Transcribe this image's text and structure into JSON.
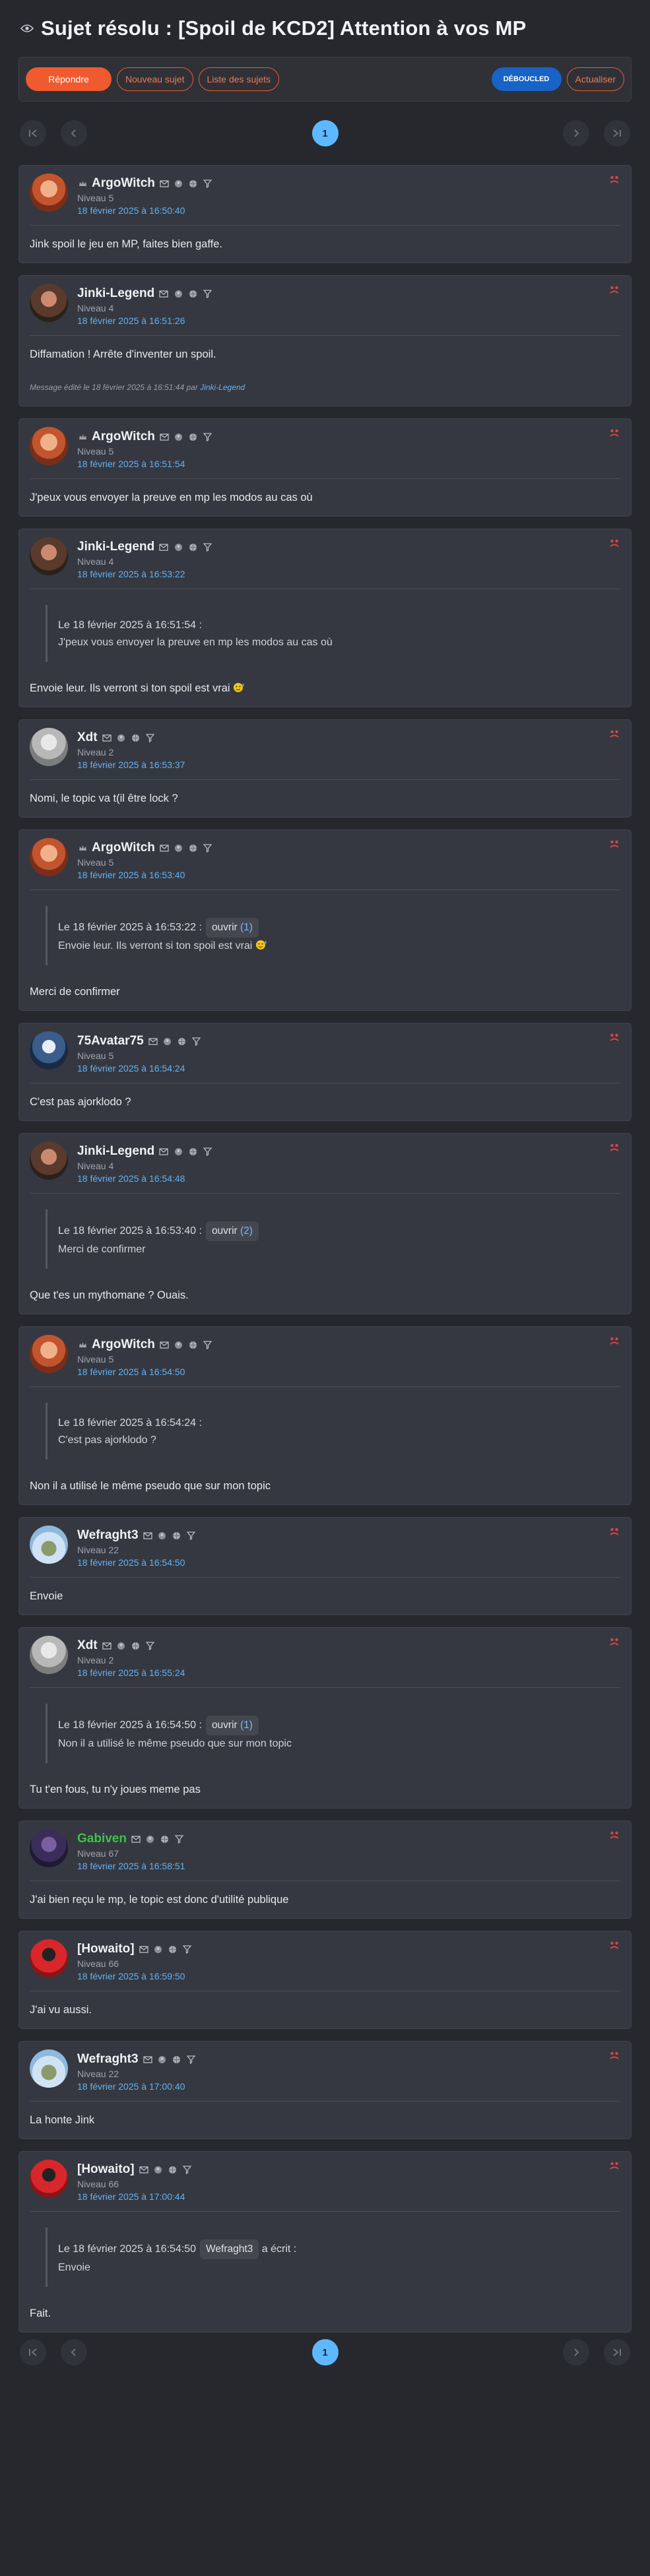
{
  "topic": {
    "title": "Sujet résolu : [Spoil de KCD2] Attention à vos MP",
    "icon": "eye-icon"
  },
  "actions": {
    "reply": "Répondre",
    "new_topic": "Nouveau sujet",
    "topic_list": "Liste des sujets",
    "debug_badge": "DÉBOUCLED",
    "refresh": "Actualiser"
  },
  "pager": {
    "current": "1"
  },
  "edited_label": {
    "prefix": "Message édité le 18 février 2025 à 16:51:44 par",
    "author": "Jinki-Legend"
  },
  "posts": [
    {
      "author": "ArgoWitch",
      "level": "Niveau 5",
      "date": "18 février 2025 à 16:50:40",
      "text": "Jink spoil le jeu en MP, faites bien gaffe."
    },
    {
      "author": "Jinki-Legend",
      "level": "Niveau 4",
      "date": "18 février 2025 à 16:51:26",
      "text": "Diffamation ! Arrête d'inventer un spoil."
    },
    {
      "author": "ArgoWitch",
      "level": "Niveau 5",
      "date": "18 février 2025 à 16:51:54",
      "text": "J'peux vous envoyer la preuve en mp les modos au cas où"
    },
    {
      "author": "Jinki-Legend",
      "level": "Niveau 4",
      "date": "18 février 2025 à 16:53:22",
      "quote_head": "Le 18 février 2025 à 16:51:54 :",
      "quote_text": "J'peux vous envoyer la preuve en mp les modos au cas où",
      "text": "Envoie leur. Ils verront si ton spoil est vrai"
    },
    {
      "author": "Xdt",
      "level": "Niveau 2",
      "date": "18 février 2025 à 16:53:37",
      "text": "Nomi, le topic va t(il être lock ?"
    },
    {
      "author": "ArgoWitch",
      "level": "Niveau 5",
      "date": "18 février 2025 à 16:53:40",
      "quote_head": "Le 18 février 2025 à 16:53:22 :",
      "quote_pill": "ouvrir",
      "quote_count": "(1)",
      "quote_text": "Envoie leur. Ils verront si ton spoil est vrai",
      "text": "Merci de confirmer"
    },
    {
      "author": "75Avatar75",
      "level": "Niveau 5",
      "date": "18 février 2025 à 16:54:24",
      "text": "C'est pas ajorklodo ?"
    },
    {
      "author": "Jinki-Legend",
      "level": "Niveau 4",
      "date": "18 février 2025 à 16:54:48",
      "quote_head": "Le 18 février 2025 à 16:53:40 :",
      "quote_pill": "ouvrir",
      "quote_count": "(2)",
      "quote_text": "Merci de confirmer",
      "text": "Que t'es un mythomane ? Ouais."
    },
    {
      "author": "ArgoWitch",
      "level": "Niveau 5",
      "date": "18 février 2025 à 16:54:50",
      "quote_head": "Le 18 février 2025 à 16:54:24 :",
      "quote_text": "C'est pas ajorklodo ?",
      "text": "Non il a utilisé le même pseudo que sur mon topic"
    },
    {
      "author": "Wefraght3",
      "level": "Niveau 22",
      "date": "18 février 2025 à 16:54:50",
      "text": "Envoie"
    },
    {
      "author": "Xdt",
      "level": "Niveau 2",
      "date": "18 février 2025 à 16:55:24",
      "quote_head": "Le 18 février 2025 à 16:54:50 :",
      "quote_pill": "ouvrir",
      "quote_count": "(1)",
      "quote_text": "Non il a utilisé le même pseudo que sur mon topic",
      "text": "Tu t'en fous, tu n'y joues meme pas"
    },
    {
      "author": "Gabiven",
      "level": "Niveau 67",
      "date": "18 février 2025 à 16:58:51",
      "text": "J'ai bien reçu le mp, le topic est donc d'utilité publique"
    },
    {
      "author": "[Howaito]",
      "level": "Niveau 66",
      "date": "18 février 2025 à 16:59:50",
      "text": "J'ai vu aussi."
    },
    {
      "author": "Wefraght3",
      "level": "Niveau 22",
      "date": "18 février 2025 à 17:00:40",
      "text": "La honte Jink"
    },
    {
      "author": "[Howaito]",
      "level": "Niveau 66",
      "date": "18 février 2025 à 17:00:44",
      "quote_head": "Le 18 février 2025 à 16:54:50",
      "quote_pill": "Wefraght3",
      "quote_suffix": "a écrit :",
      "quote_text": "Envoie",
      "text": "Fait."
    }
  ],
  "colors": {
    "accent": "#ef5a2f",
    "link": "#63b2f5",
    "moderator_green": "#3fc14a",
    "alert_red": "#e0443c"
  }
}
